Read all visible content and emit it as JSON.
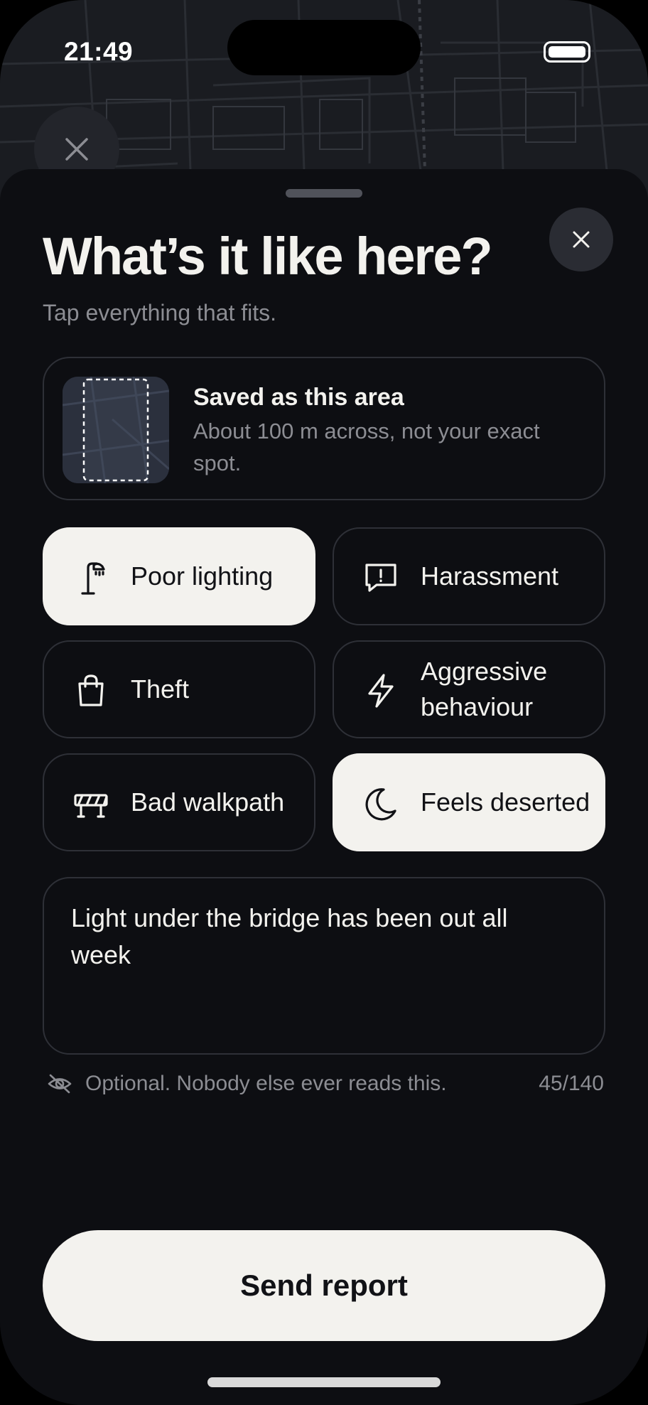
{
  "status_bar": {
    "time": "21:49"
  },
  "sheet": {
    "title": "What’s it like here?",
    "subtitle": "Tap everything that fits."
  },
  "area_card": {
    "title": "Saved as this area",
    "description": "About 100 m across, not your exact spot."
  },
  "categories": [
    {
      "label": "Poor lighting",
      "icon": "street-lamp-icon",
      "selected": true
    },
    {
      "label": "Harassment",
      "icon": "report-message-icon",
      "selected": false
    },
    {
      "label": "Theft",
      "icon": "shopping-bag-icon",
      "selected": false
    },
    {
      "label": "Aggressive behaviour",
      "icon": "lightning-icon",
      "selected": false
    },
    {
      "label": "Bad walkpath",
      "icon": "road-barrier-icon",
      "selected": false
    },
    {
      "label": "Feels deserted",
      "icon": "moon-icon",
      "selected": true
    }
  ],
  "note": {
    "value": "Light under the bridge has been out all week",
    "privacy_hint": "Optional. Nobody else ever reads this.",
    "counter": "45/140"
  },
  "actions": {
    "send_label": "Send report"
  },
  "colors": {
    "background": "#0d0e12",
    "surface_border": "#2e3037",
    "chip_selected": "#f3f2ee",
    "text_primary": "#f3f2ee",
    "text_secondary": "#8c8d93"
  }
}
